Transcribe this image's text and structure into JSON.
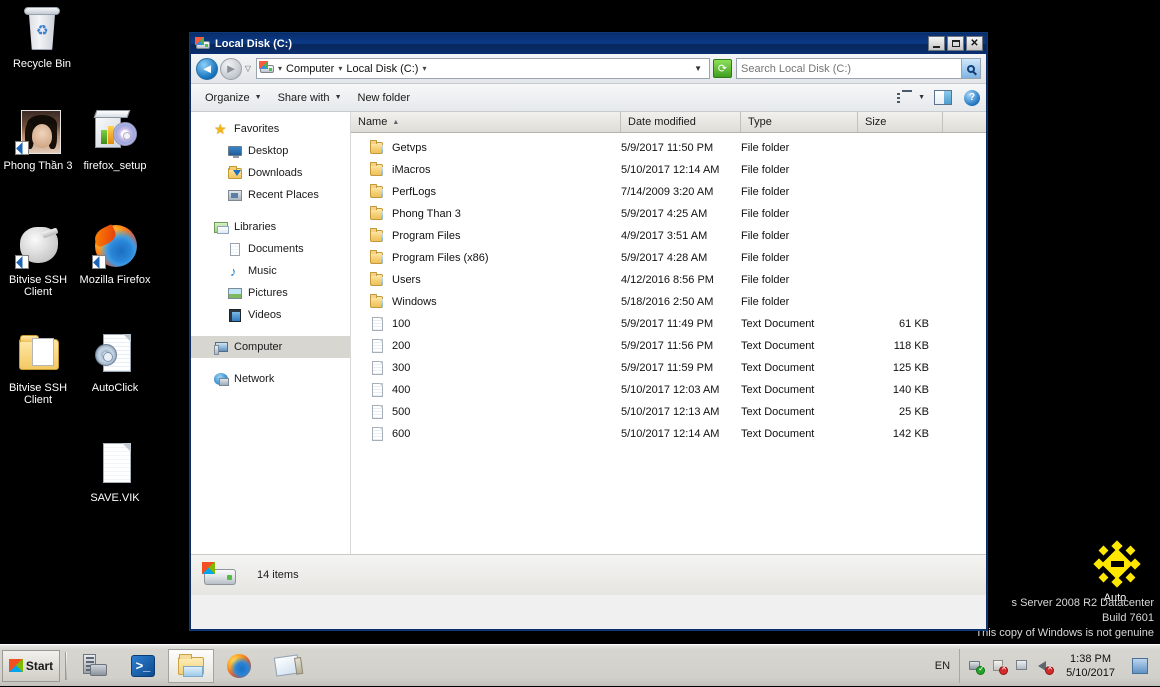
{
  "desktop": {
    "icons": [
      {
        "name": "Recycle Bin",
        "icon": "recycle-bin-icon"
      },
      {
        "name": "Phong Thần 3",
        "icon": "image-shortcut-icon"
      },
      {
        "name": "firefox_setup",
        "icon": "installer-cd-icon"
      },
      {
        "name": "Bitvise SSH Client",
        "icon": "bitvise-ssh-client-shortcut-icon"
      },
      {
        "name": "Mozilla Firefox",
        "icon": "firefox-shortcut-icon"
      },
      {
        "name": "Bitvise SSH Client",
        "icon": "folder-icon"
      },
      {
        "name": "AutoClick",
        "icon": "autoclick-icon"
      },
      {
        "name": "SAVE.VIK",
        "icon": "file-icon"
      },
      {
        "name": "Auto",
        "icon": "auto-diamond-icon"
      }
    ],
    "watermark": {
      "line1": "s Server 2008 R2 Datacenter",
      "line2": "Build 7601",
      "line3": "This copy of Windows is not genuine"
    }
  },
  "window": {
    "title": "Local Disk (C:)",
    "buttons": {
      "minimize": "–",
      "maximize": "□",
      "close": "✕"
    },
    "nav": {
      "back": "◄",
      "forward": "►",
      "history_caret": "▽",
      "breadcrumb": [
        "Computer",
        "Local Disk (C:)"
      ],
      "separator": "▾",
      "address_dropdown": "▼",
      "refresh": "⟳"
    },
    "search": {
      "placeholder": "Search Local Disk (C:)",
      "value": "",
      "button": "search-icon"
    },
    "commandbar": {
      "organize": "Organize",
      "share_with": "Share with",
      "new_folder": "New folder",
      "caret": "▼",
      "help": "?"
    }
  },
  "navpane": {
    "groups": [
      {
        "header": "Favorites",
        "icon": "star-icon",
        "items": [
          {
            "label": "Desktop",
            "icon": "desktop-icon"
          },
          {
            "label": "Downloads",
            "icon": "downloads-folder-icon"
          },
          {
            "label": "Recent Places",
            "icon": "recent-places-icon"
          }
        ]
      },
      {
        "header": "Libraries",
        "icon": "libraries-icon",
        "items": [
          {
            "label": "Documents",
            "icon": "documents-icon"
          },
          {
            "label": "Music",
            "icon": "music-icon"
          },
          {
            "label": "Pictures",
            "icon": "pictures-icon"
          },
          {
            "label": "Videos",
            "icon": "videos-icon"
          }
        ]
      },
      {
        "header": "Computer",
        "icon": "computer-icon",
        "selected": true,
        "items": []
      },
      {
        "header": "Network",
        "icon": "network-icon",
        "items": []
      }
    ]
  },
  "filelist": {
    "columns": [
      {
        "label": "Name",
        "sorted": "asc",
        "caret": "▲"
      },
      {
        "label": "Date modified"
      },
      {
        "label": "Type"
      },
      {
        "label": "Size"
      }
    ],
    "rows": [
      {
        "icon": "folder-icon",
        "name": "Getvps",
        "date": "5/9/2017 11:50 PM",
        "type": "File folder",
        "size": ""
      },
      {
        "icon": "folder-icon",
        "name": "iMacros",
        "date": "5/10/2017 12:14 AM",
        "type": "File folder",
        "size": ""
      },
      {
        "icon": "folder-icon",
        "name": "PerfLogs",
        "date": "7/14/2009 3:20 AM",
        "type": "File folder",
        "size": ""
      },
      {
        "icon": "folder-icon",
        "name": "Phong Than 3",
        "date": "5/9/2017 4:25 AM",
        "type": "File folder",
        "size": ""
      },
      {
        "icon": "folder-icon",
        "name": "Program Files",
        "date": "4/9/2017 3:51 AM",
        "type": "File folder",
        "size": ""
      },
      {
        "icon": "folder-icon",
        "name": "Program Files (x86)",
        "date": "5/9/2017 4:28 AM",
        "type": "File folder",
        "size": ""
      },
      {
        "icon": "folder-icon",
        "name": "Users",
        "date": "4/12/2016 8:56 PM",
        "type": "File folder",
        "size": ""
      },
      {
        "icon": "folder-icon",
        "name": "Windows",
        "date": "5/18/2016 2:50 AM",
        "type": "File folder",
        "size": ""
      },
      {
        "icon": "text-document-icon",
        "name": "100",
        "date": "5/9/2017 11:49 PM",
        "type": "Text Document",
        "size": "61 KB"
      },
      {
        "icon": "text-document-icon",
        "name": "200",
        "date": "5/9/2017 11:56 PM",
        "type": "Text Document",
        "size": "118 KB"
      },
      {
        "icon": "text-document-icon",
        "name": "300",
        "date": "5/9/2017 11:59 PM",
        "type": "Text Document",
        "size": "125 KB"
      },
      {
        "icon": "text-document-icon",
        "name": "400",
        "date": "5/10/2017 12:03 AM",
        "type": "Text Document",
        "size": "140 KB"
      },
      {
        "icon": "text-document-icon",
        "name": "500",
        "date": "5/10/2017 12:13 AM",
        "type": "Text Document",
        "size": "25 KB"
      },
      {
        "icon": "text-document-icon",
        "name": "600",
        "date": "5/10/2017 12:14 AM",
        "type": "Text Document",
        "size": "142 KB"
      }
    ]
  },
  "statusbar": {
    "items_count": "14 items",
    "icon": "local-disk-icon"
  },
  "taskbar": {
    "start": "Start",
    "buttons": [
      {
        "icon": "server-manager-icon",
        "active": false
      },
      {
        "icon": "powershell-icon",
        "active": false
      },
      {
        "icon": "explorer-icon",
        "active": true
      },
      {
        "icon": "firefox-icon",
        "active": false
      },
      {
        "icon": "notepad-icon",
        "active": false
      }
    ],
    "tray": {
      "language": "EN",
      "icons": [
        "network-ok-icon",
        "flag-error-icon",
        "disk-icon",
        "volume-muted-icon"
      ],
      "time": "1:38 PM",
      "date": "5/10/2017",
      "show_desktop": "show-desktop-icon"
    }
  },
  "colors": {
    "titlebar": "#0b3a86",
    "desktop_bg": "#000000",
    "taskbar": "#d2d0ca",
    "selection": "#d8d6d0",
    "accent_green": "#3f9f20"
  }
}
